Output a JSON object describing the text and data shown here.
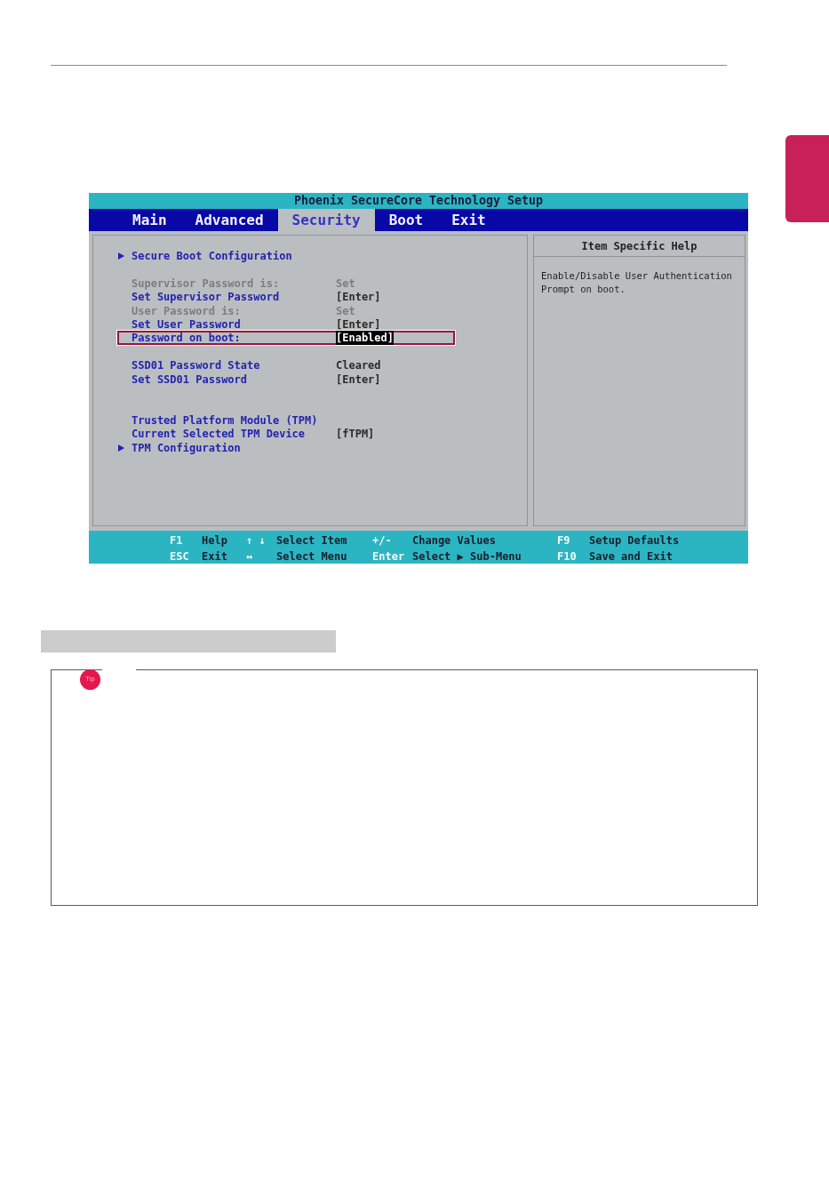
{
  "bios": {
    "title": "Phoenix SecureCore Technology Setup",
    "menu": [
      {
        "label": "Main",
        "selected": false
      },
      {
        "label": "Advanced",
        "selected": false
      },
      {
        "label": "Security",
        "selected": true
      },
      {
        "label": "Boot",
        "selected": false
      },
      {
        "label": "Exit",
        "selected": false
      }
    ],
    "groups": [
      {
        "rows": [
          {
            "kind": "submenu",
            "label": "Secure Boot Configuration",
            "disabled": false,
            "selected": false
          }
        ]
      },
      {
        "rows": [
          {
            "kind": "setting",
            "label": "Supervisor Password is:",
            "value": "Set",
            "disabled": true,
            "selected": false
          },
          {
            "kind": "setting",
            "label": "Set Supervisor Password",
            "value": "[Enter]",
            "disabled": false,
            "selected": false
          },
          {
            "kind": "setting",
            "label": "User Password is:",
            "value": "Set",
            "disabled": true,
            "selected": false
          },
          {
            "kind": "setting",
            "label": "Set User Password",
            "value": "[Enter]",
            "disabled": false,
            "selected": false
          },
          {
            "kind": "setting",
            "label": "Password on boot:",
            "value": "[Enabled]",
            "disabled": false,
            "selected": true
          }
        ]
      },
      {
        "rows": [
          {
            "kind": "setting",
            "label": "SSD01 Password State",
            "value": "Cleared",
            "disabled": false,
            "selected": false
          },
          {
            "kind": "setting",
            "label": "Set SSD01 Password",
            "value": "[Enter]",
            "disabled": false,
            "selected": false
          }
        ]
      },
      {
        "rows": [
          {
            "kind": "heading",
            "label": "Trusted Platform Module (TPM)",
            "disabled": false,
            "selected": false
          },
          {
            "kind": "setting",
            "label": "Current Selected TPM Device",
            "value": "[fTPM]",
            "disabled": false,
            "selected": false
          },
          {
            "kind": "submenu",
            "label": "TPM Configuration",
            "disabled": false,
            "selected": false
          }
        ]
      }
    ],
    "help": {
      "title": "Item Specific Help",
      "text": "Enable/Disable User Authentication Prompt on boot."
    },
    "legend": [
      {
        "key": "F1",
        "action": "Help"
      },
      {
        "key": "↑ ↓",
        "action": "Select Item"
      },
      {
        "key": "+/-",
        "action": "Change Values"
      },
      {
        "key": "F9",
        "action": "Setup Defaults"
      },
      {
        "key": "ESC",
        "action": "Exit"
      },
      {
        "key": "↔",
        "action": "Select Menu"
      },
      {
        "key": "Enter",
        "action": "Select ▶ Sub-Menu"
      },
      {
        "key": "F10",
        "action": "Save and Exit"
      }
    ]
  },
  "tip": {
    "badge": "Tip"
  }
}
